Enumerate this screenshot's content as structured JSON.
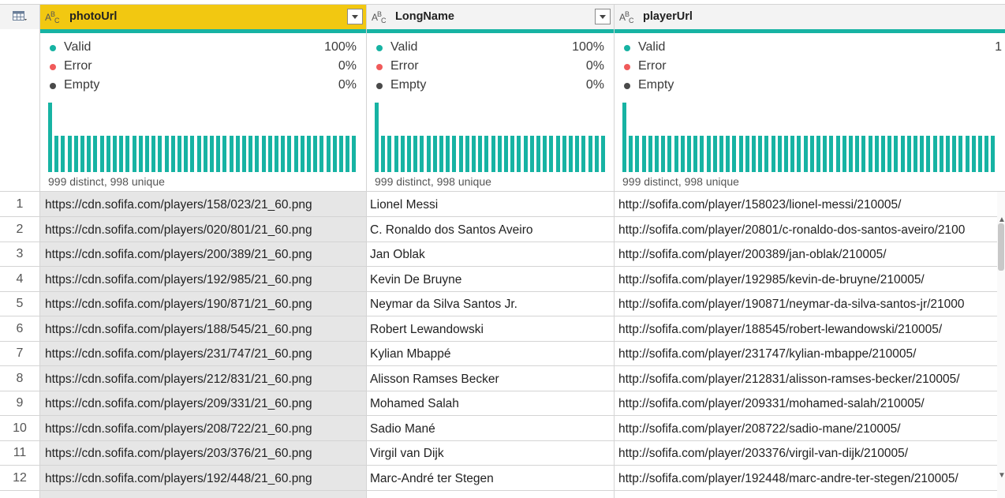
{
  "columns": [
    {
      "name": "photoUrl",
      "type_icon": "text-type-icon",
      "selected": true,
      "quality": {
        "valid_label": "Valid",
        "valid_pct": "100%",
        "error_label": "Error",
        "error_pct": "0%",
        "empty_label": "Empty",
        "empty_pct": "0%"
      },
      "distinct_text": "999 distinct, 998 unique"
    },
    {
      "name": "LongName",
      "type_icon": "text-type-icon",
      "selected": false,
      "quality": {
        "valid_label": "Valid",
        "valid_pct": "100%",
        "error_label": "Error",
        "error_pct": "0%",
        "empty_label": "Empty",
        "empty_pct": "0%"
      },
      "distinct_text": "999 distinct, 998 unique"
    },
    {
      "name": "playerUrl",
      "type_icon": "text-type-icon",
      "selected": false,
      "quality": {
        "valid_label": "Valid",
        "valid_pct": "1",
        "error_label": "Error",
        "error_pct": "",
        "empty_label": "Empty",
        "empty_pct": ""
      },
      "distinct_text": "999 distinct, 998 unique"
    }
  ],
  "colors": {
    "valid": "#17b3a3",
    "error": "#f05a5a",
    "empty": "#4a4a4a",
    "selected_header": "#f2c811"
  },
  "rows": [
    {
      "num": "1",
      "photoUrl": "https://cdn.sofifa.com/players/158/023/21_60.png",
      "LongName": "Lionel Messi",
      "playerUrl": "http://sofifa.com/player/158023/lionel-messi/210005/"
    },
    {
      "num": "2",
      "photoUrl": "https://cdn.sofifa.com/players/020/801/21_60.png",
      "LongName": "C. Ronaldo dos Santos Aveiro",
      "playerUrl": "http://sofifa.com/player/20801/c-ronaldo-dos-santos-aveiro/2100"
    },
    {
      "num": "3",
      "photoUrl": "https://cdn.sofifa.com/players/200/389/21_60.png",
      "LongName": "Jan Oblak",
      "playerUrl": "http://sofifa.com/player/200389/jan-oblak/210005/"
    },
    {
      "num": "4",
      "photoUrl": "https://cdn.sofifa.com/players/192/985/21_60.png",
      "LongName": "Kevin De Bruyne",
      "playerUrl": "http://sofifa.com/player/192985/kevin-de-bruyne/210005/"
    },
    {
      "num": "5",
      "photoUrl": "https://cdn.sofifa.com/players/190/871/21_60.png",
      "LongName": "Neymar da Silva Santos Jr.",
      "playerUrl": "http://sofifa.com/player/190871/neymar-da-silva-santos-jr/21000"
    },
    {
      "num": "6",
      "photoUrl": "https://cdn.sofifa.com/players/188/545/21_60.png",
      "LongName": "Robert Lewandowski",
      "playerUrl": "http://sofifa.com/player/188545/robert-lewandowski/210005/"
    },
    {
      "num": "7",
      "photoUrl": "https://cdn.sofifa.com/players/231/747/21_60.png",
      "LongName": "Kylian Mbappé",
      "playerUrl": "http://sofifa.com/player/231747/kylian-mbappe/210005/"
    },
    {
      "num": "8",
      "photoUrl": "https://cdn.sofifa.com/players/212/831/21_60.png",
      "LongName": "Alisson Ramses Becker",
      "playerUrl": "http://sofifa.com/player/212831/alisson-ramses-becker/210005/"
    },
    {
      "num": "9",
      "photoUrl": "https://cdn.sofifa.com/players/209/331/21_60.png",
      "LongName": "Mohamed Salah",
      "playerUrl": "http://sofifa.com/player/209331/mohamed-salah/210005/"
    },
    {
      "num": "10",
      "photoUrl": "https://cdn.sofifa.com/players/208/722/21_60.png",
      "LongName": "Sadio Mané",
      "playerUrl": "http://sofifa.com/player/208722/sadio-mane/210005/"
    },
    {
      "num": "11",
      "photoUrl": "https://cdn.sofifa.com/players/203/376/21_60.png",
      "LongName": "Virgil van Dijk",
      "playerUrl": "http://sofifa.com/player/203376/virgil-van-dijk/210005/"
    },
    {
      "num": "12",
      "photoUrl": "https://cdn.sofifa.com/players/192/448/21_60.png",
      "LongName": "Marc-André ter Stegen",
      "playerUrl": "http://sofifa.com/player/192448/marc-andre-ter-stegen/210005/"
    }
  ]
}
